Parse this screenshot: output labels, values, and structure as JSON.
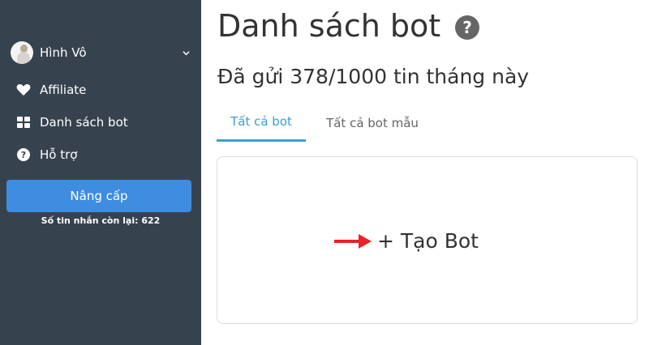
{
  "sidebar": {
    "user_name": "Hình Vô",
    "items": [
      {
        "label": "Affiliate",
        "icon": "heart-icon"
      },
      {
        "label": "Danh sách bot",
        "icon": "grid-icon"
      },
      {
        "label": "Hỗ trợ",
        "icon": "question-circle-icon"
      }
    ],
    "upgrade_label": "Nâng cấp",
    "remaining_text": "Số tin nhắn còn lại: 622"
  },
  "main": {
    "title": "Danh sách bot",
    "sent_text": "Đã gửi 378/1000 tin tháng này",
    "tabs": [
      {
        "label": "Tất cả bot",
        "active": true
      },
      {
        "label": "Tất cả bot mẫu",
        "active": false
      }
    ],
    "create_bot_label": "+ Tạo Bot"
  },
  "colors": {
    "sidebar_bg": "#37424f",
    "accent": "#3a9fd0",
    "upgrade_button": "#3e8de0",
    "arrow": "#e8222a"
  }
}
